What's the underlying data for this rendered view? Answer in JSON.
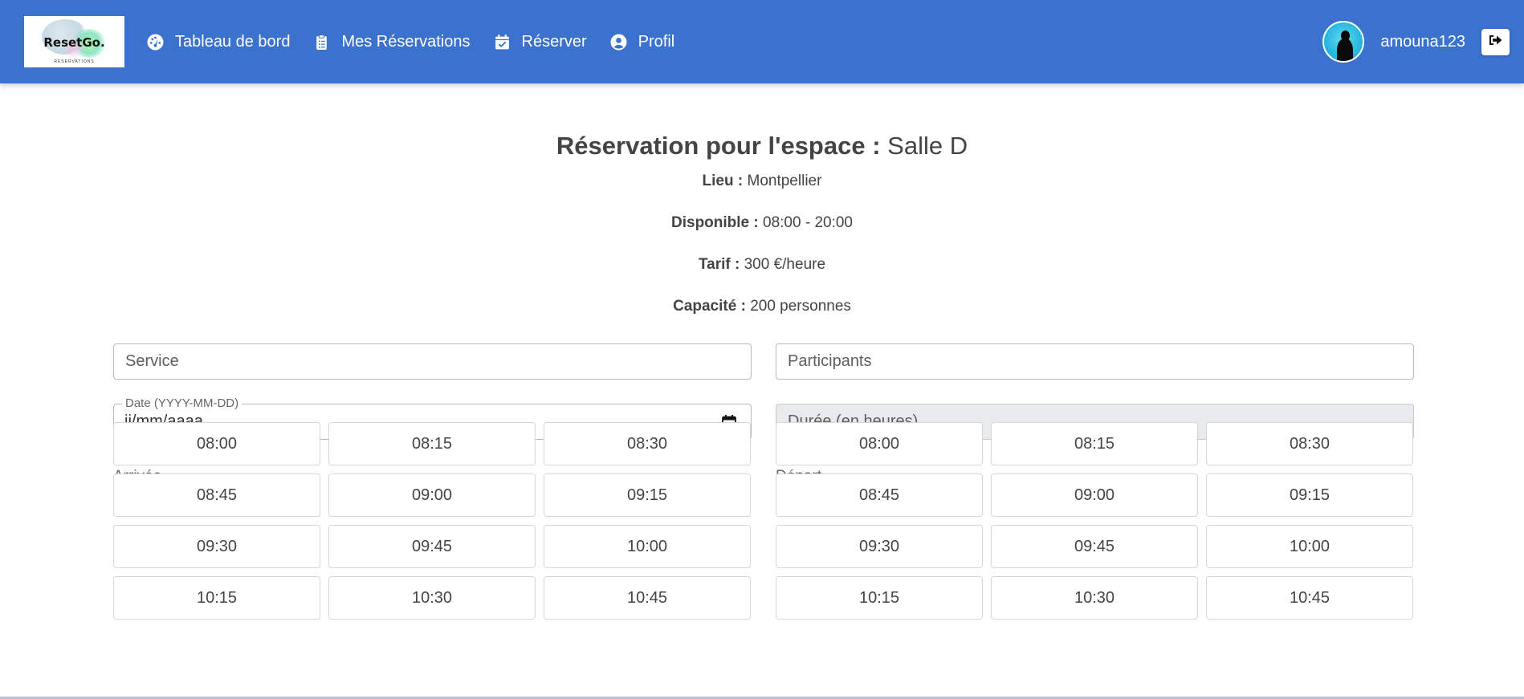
{
  "brand": {
    "name": "ResetGo.",
    "tagline": "RESERVATIONS"
  },
  "nav": {
    "items": [
      {
        "label": "Tableau de bord",
        "icon": "dashboard-gauge-icon"
      },
      {
        "label": "Mes Réservations",
        "icon": "clipboard-icon"
      },
      {
        "label": "Réserver",
        "icon": "calendar-check-icon"
      },
      {
        "label": "Profil",
        "icon": "user-circle-icon"
      }
    ],
    "username": "amouna123",
    "logout_icon": "sign-out-icon"
  },
  "reservation": {
    "title_label": "Réservation pour l'espace :",
    "space_name": "Salle D",
    "location_label": "Lieu :",
    "location_value": "Montpellier",
    "available_label": "Disponible :",
    "available_value": "08:00 - 20:00",
    "rate_label": "Tarif :",
    "rate_value": "300 €/heure",
    "capacity_label": "Capacité :",
    "capacity_value": "200 personnes"
  },
  "form": {
    "service_placeholder": "Service",
    "participants_placeholder": "Participants",
    "date_label": "Date (YYYY-MM-DD)",
    "date_value": "jj/mm/aaaa",
    "duration_placeholder": "Durée (en heures)",
    "arrival_label": "Arrivée",
    "departure_label": "Départ"
  },
  "arrival_slots": [
    "08:00",
    "08:15",
    "08:30",
    "08:45",
    "09:00",
    "09:15",
    "09:30",
    "09:45",
    "10:00",
    "10:15",
    "10:30",
    "10:45"
  ],
  "departure_slots": [
    "08:00",
    "08:15",
    "08:30",
    "08:45",
    "09:00",
    "09:15",
    "09:30",
    "09:45",
    "10:00",
    "10:15",
    "10:30",
    "10:45"
  ],
  "colors": {
    "navbar": "#3b72cd",
    "text": "#444444",
    "disabled_field": "#e8eaed"
  }
}
